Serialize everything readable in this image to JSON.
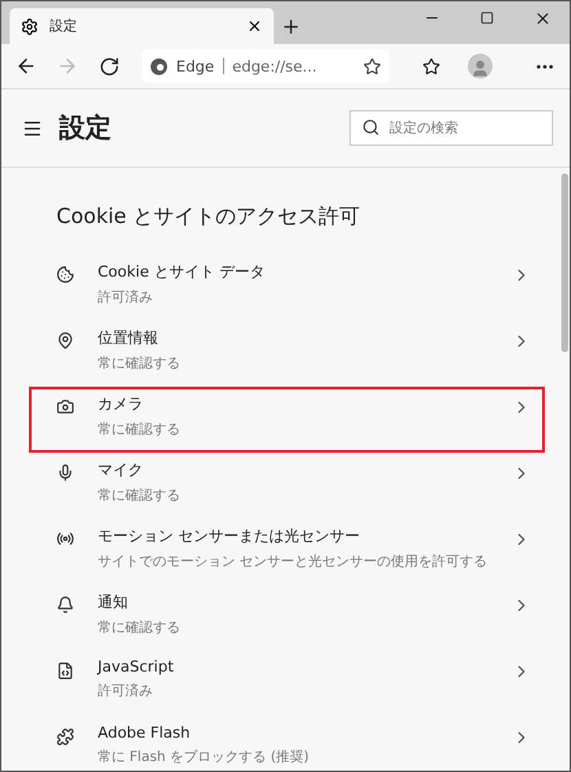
{
  "tab": {
    "title": "設定",
    "selected": true
  },
  "address_bar": {
    "site": "Edge",
    "url": "edge://se..."
  },
  "header": {
    "title": "設定",
    "search": {
      "placeholder": "設定の検索"
    }
  },
  "section": {
    "title": "Cookie とサイトのアクセス許可",
    "items": [
      {
        "title": "Cookie とサイト データ",
        "subtitle": "許可済み",
        "highlighted": false
      },
      {
        "title": "位置情報",
        "subtitle": "常に確認する",
        "highlighted": false
      },
      {
        "title": "カメラ",
        "subtitle": "常に確認する",
        "highlighted": true
      },
      {
        "title": "マイク",
        "subtitle": "常に確認する",
        "highlighted": false
      },
      {
        "title": "モーション センサーまたは光センサー",
        "subtitle": "サイトでのモーション センサーと光センサーの使用を許可する",
        "highlighted": false
      },
      {
        "title": "通知",
        "subtitle": "常に確認する",
        "highlighted": false
      },
      {
        "title": "JavaScript",
        "subtitle": "許可済み",
        "highlighted": false
      },
      {
        "title": "Adobe Flash",
        "subtitle": "常に Flash をブロックする (推奨)",
        "highlighted": false
      }
    ]
  }
}
